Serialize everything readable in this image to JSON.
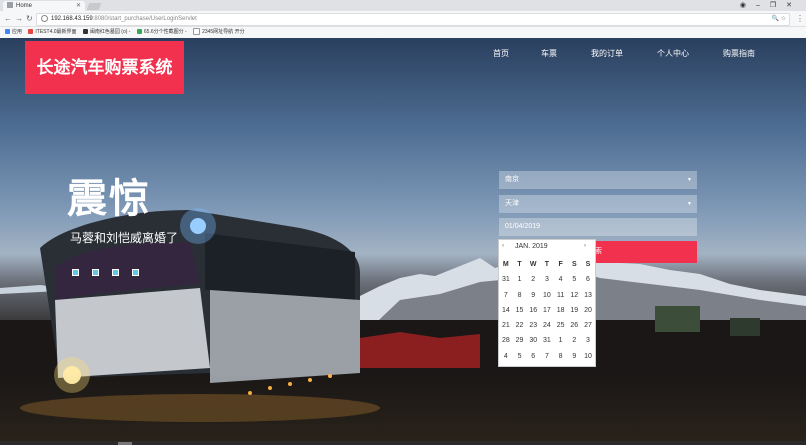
{
  "browser": {
    "tab_title": "Home",
    "url_host": "192.168.43.159",
    "url_rest": ":8080/start_purchase/UserLoginServlet",
    "bookmarks": [
      {
        "label": "应用",
        "color": "#4285f4"
      },
      {
        "label": "ITEST4.0最新界面",
        "color": "#e8453c"
      },
      {
        "label": "闽南红色墓园 (o) -",
        "color": "#333333"
      },
      {
        "label": "65.6分个性截图分 -",
        "color": "#34a853"
      },
      {
        "label": "2345网址导航 开分",
        "color": "#999999"
      }
    ]
  },
  "site": {
    "brand": "长途汽车购票系统",
    "brand_color": "#f2314e",
    "nav": [
      "首页",
      "车票",
      "我的订单",
      "个人中心",
      "购票指南"
    ]
  },
  "hero": {
    "title": "震惊",
    "subtitle": "马蓉和刘恺威离婚了"
  },
  "form": {
    "origin": "南京",
    "destination": "天津",
    "date": "01/04/2019",
    "submit_partial": "索"
  },
  "datepicker": {
    "prev": "‹",
    "next": "›",
    "month": "JAN. 2019",
    "weekdays": [
      "M",
      "T",
      "W",
      "T",
      "F",
      "S",
      "S"
    ],
    "weeks": [
      [
        "31",
        "1",
        "2",
        "3",
        "4",
        "5",
        "6"
      ],
      [
        "7",
        "8",
        "9",
        "10",
        "11",
        "12",
        "13"
      ],
      [
        "14",
        "15",
        "16",
        "17",
        "18",
        "19",
        "20"
      ],
      [
        "21",
        "22",
        "23",
        "24",
        "25",
        "26",
        "27"
      ],
      [
        "28",
        "29",
        "30",
        "31",
        "1",
        "2",
        "3"
      ],
      [
        "4",
        "5",
        "6",
        "7",
        "8",
        "9",
        "10"
      ]
    ]
  }
}
